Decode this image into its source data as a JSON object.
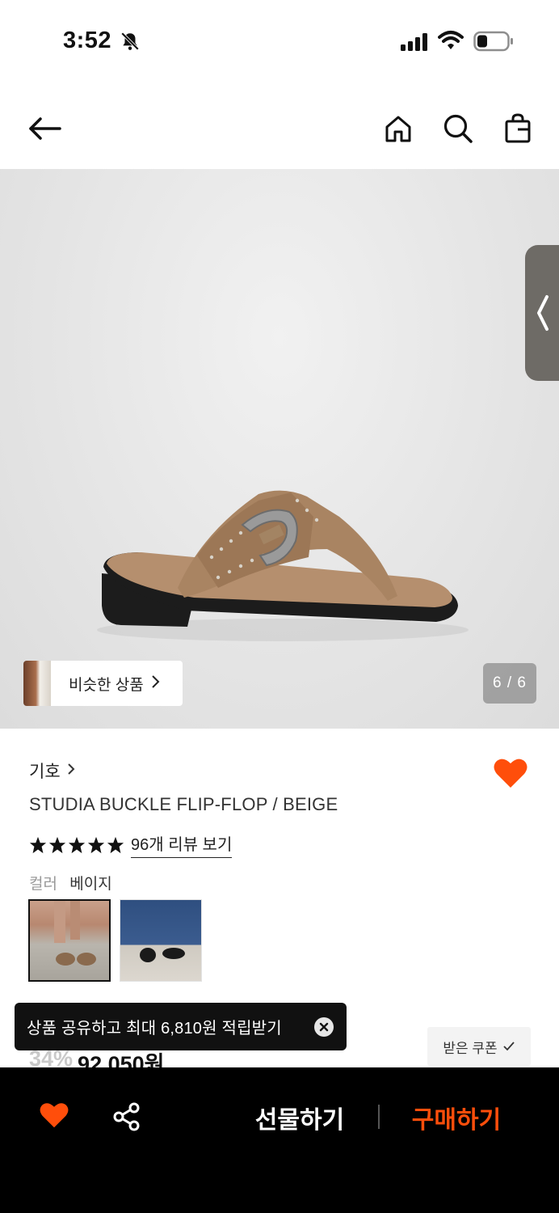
{
  "status_bar": {
    "time": "3:52"
  },
  "header": {
    "icons": [
      "back-arrow-icon",
      "home-icon",
      "search-icon",
      "shopping-bag-icon"
    ]
  },
  "gallery": {
    "similar_products_label": "비슷한 상품",
    "page_counter": "6 / 6"
  },
  "product": {
    "brand": "기호",
    "name": "STUDIA BUCKLE FLIP-FLOP / BEIGE",
    "rating_stars": 5,
    "review_link": "96개 리뷰 보기",
    "color_label": "컬러",
    "color_value": "베이지",
    "discount": "34%",
    "price": "92,050원"
  },
  "toast": {
    "message": "상품 공유하고 최대 6,810원 적립받기"
  },
  "coupon": {
    "label": "받은 쿠폰"
  },
  "bottom_bar": {
    "gift_label": "선물하기",
    "buy_label": "구매하기"
  },
  "colors": {
    "accent": "#ff4e0b",
    "heart": "#ff4e0b",
    "bottom_bar_bg": "#000000"
  }
}
